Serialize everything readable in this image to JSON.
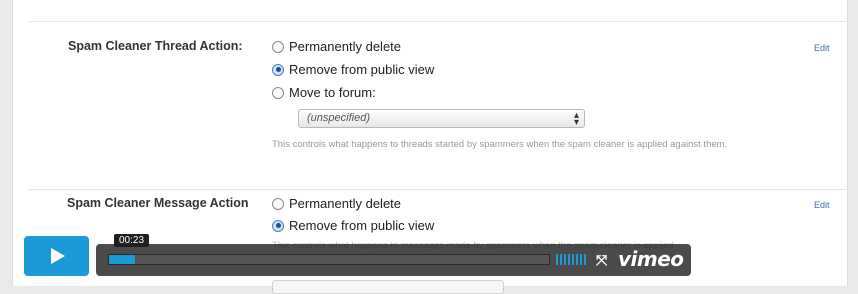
{
  "settings": {
    "thread_action": {
      "label": "Spam Cleaner Thread Action:",
      "edit": "Edit",
      "options": [
        {
          "label": "Permanently delete",
          "checked": false
        },
        {
          "label": "Remove from public view",
          "checked": true
        },
        {
          "label": "Move to forum:",
          "checked": false
        }
      ],
      "forum_select": {
        "value": "(unspecified)"
      },
      "description": "This controls what happens to threads started by spammers when the spam cleaner is applied against them."
    },
    "message_action": {
      "label": "Spam Cleaner Message Action",
      "edit": "Edit",
      "options": [
        {
          "label": "Permanently delete",
          "checked": false
        },
        {
          "label": "Remove from public view",
          "checked": true
        }
      ],
      "description": "This controls what happens to messages made by spammers when the spam cleaner is applied"
    }
  },
  "player": {
    "timecode": "00:23",
    "progress_percent": 6,
    "logo": "vimeo",
    "icons": {
      "play": "play-icon",
      "fullscreen": "fullscreen-icon",
      "volume": "volume-icon"
    },
    "accent": "#1a9bd8"
  }
}
